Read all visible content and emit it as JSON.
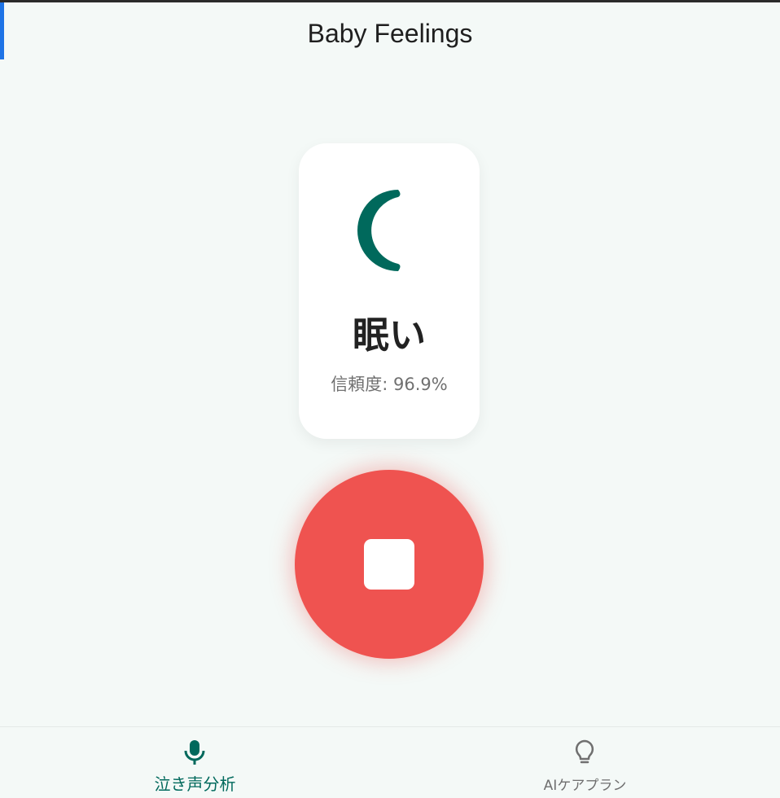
{
  "app": {
    "title": "Baby Feelings"
  },
  "result": {
    "emotion": "眠い",
    "confidence": "信頼度: 96.9%",
    "icon": "moon-icon"
  },
  "record": {
    "state": "recording",
    "icon": "stop-icon"
  },
  "nav": {
    "items": [
      {
        "label": "泣き声分析",
        "icon": "microphone-icon",
        "active": true
      },
      {
        "label": "AIケアプラン",
        "icon": "lightbulb-icon",
        "active": false
      }
    ]
  },
  "colors": {
    "accent": "#00695c",
    "record": "#ef5350",
    "background": "#f4f9f7",
    "indicator": "#1e74e6"
  }
}
